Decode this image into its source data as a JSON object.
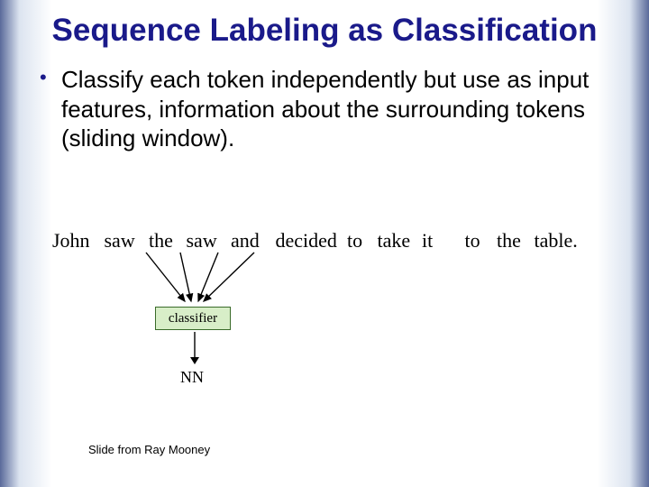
{
  "title": "Sequence Labeling as Classification",
  "bullet": "Classify each token independently but use as input features, information about the surrounding tokens (sliding window).",
  "sentence": {
    "tokens": [
      "John",
      "saw",
      "the",
      "saw",
      "and",
      "decided",
      "to",
      "take",
      "it",
      "to",
      "the",
      "table."
    ]
  },
  "classifier_label": "classifier",
  "output_label": "NN",
  "footer": "Slide from Ray Mooney"
}
